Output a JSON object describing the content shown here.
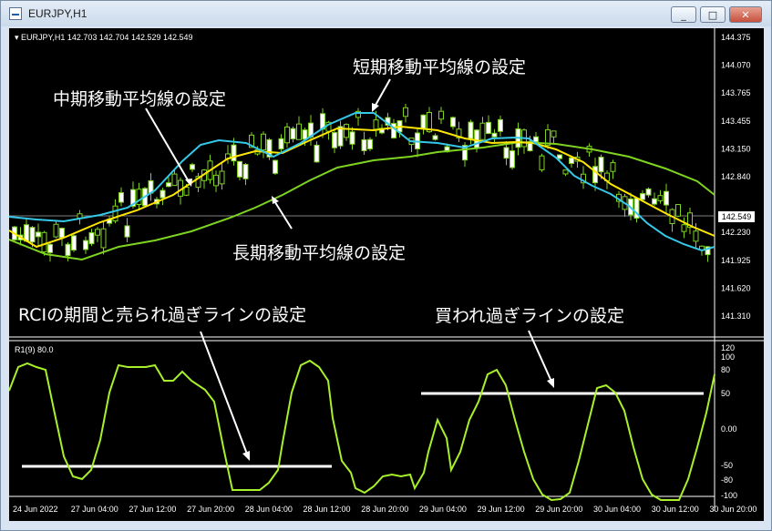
{
  "window": {
    "title": "EURJPY,H1",
    "controls": {
      "minimize": "_",
      "maximize": "□",
      "close": "✕"
    }
  },
  "chart": {
    "info": "▾ EURJPY,H1  142.703 142.704 142.529 142.549",
    "current_price": "142.549",
    "price_ticks": [
      "144.375",
      "144.070",
      "143.765",
      "143.455",
      "143.150",
      "142.840",
      "142.549",
      "142.230",
      "141.925",
      "141.620",
      "141.310"
    ],
    "sub_info": "R1(9) 80.0",
    "sub_ticks": [
      "120",
      "100",
      "80",
      "50",
      "0.00",
      "-50",
      "-80",
      "-100"
    ],
    "time_ticks": [
      "24 Jun 2022",
      "27 Jun 04:00",
      "27 Jun 12:00",
      "27 Jun 20:00",
      "28 Jun 04:00",
      "28 Jun 12:00",
      "28 Jun 20:00",
      "29 Jun 04:00",
      "29 Jun 12:00",
      "29 Jun 20:00",
      "30 Jun 04:00",
      "30 Jun 12:00",
      "30 Jun 20:00"
    ],
    "colors": {
      "short_ma": "#35c8e8",
      "mid_ma": "#ffe600",
      "long_ma": "#7ed321",
      "candle": "#7ed321",
      "rci": "#a8f02a",
      "level_line": "#ffffff"
    }
  },
  "annotations": {
    "short": "短期移動平均線の設定",
    "mid": "中期移動平均線の設定",
    "long": "長期移動平均線の設定",
    "rci": "RCIの期間と売られ過ぎラインの設定",
    "overbought": "買われ過ぎラインの設定"
  }
}
